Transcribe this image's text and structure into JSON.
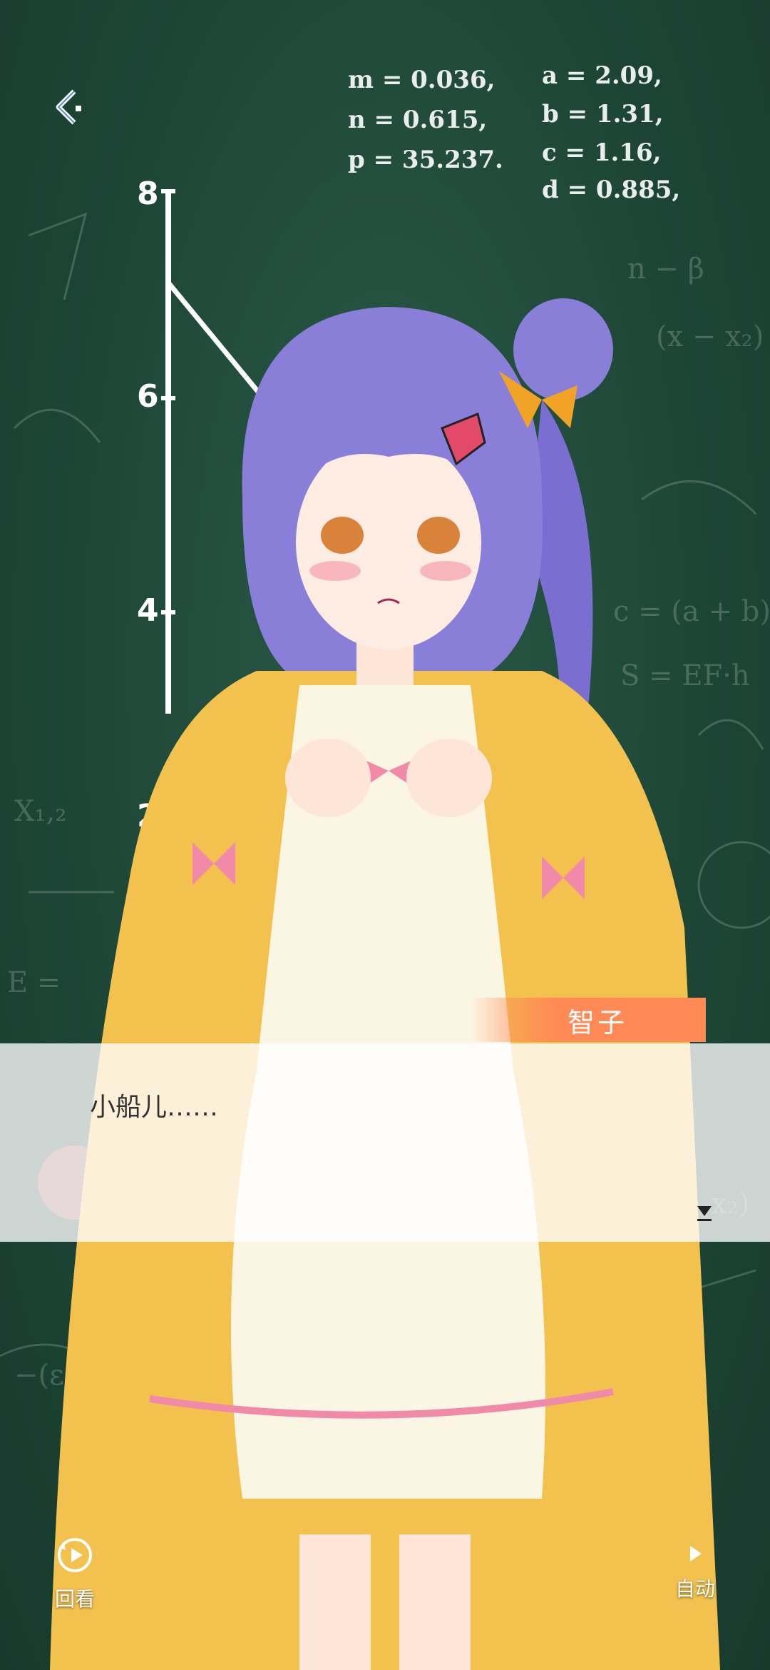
{
  "formulas": {
    "left": [
      "m = 0.036,",
      "n = 0.615,",
      "p = 35.237."
    ],
    "right": [
      "a = 2.09,",
      "b = 1.31,",
      "c = 1.16,",
      "d = 0.885,"
    ]
  },
  "ruler": {
    "labels": [
      "8",
      "6",
      "4",
      "2"
    ]
  },
  "dialog": {
    "speaker": "智子",
    "text": "小船儿……"
  },
  "controls": {
    "review_label": "回看",
    "auto_label": "自动"
  },
  "icons": {
    "back": "back-arrow-icon",
    "review": "replay-icon",
    "auto": "play-icon",
    "next": "next-page-icon"
  },
  "colors": {
    "board": "#1f4a3a",
    "name_plate": "#ff8a55",
    "hair": "#8a7fd8",
    "jacket": "#f2c14e",
    "dress": "#fbf6e4",
    "bow": "#f08aa8"
  }
}
